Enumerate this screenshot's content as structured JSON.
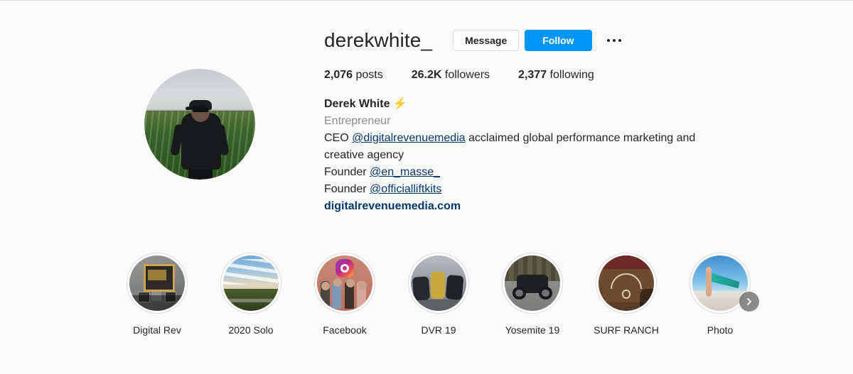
{
  "profile": {
    "username": "derekwhite_",
    "avatar_alt": "man-in-black-jacket-standing-in-green-crop-field",
    "actions": {
      "message_label": "Message",
      "follow_label": "Follow",
      "more_label": "More options"
    },
    "stats": [
      {
        "number": "2,076",
        "label": "posts"
      },
      {
        "number": "26.2K",
        "label": "followers"
      },
      {
        "number": "2,377",
        "label": "following"
      }
    ],
    "bio": {
      "full_name": "Derek White",
      "name_emoji": "⚡",
      "category": "Entrepreneur",
      "lines": [
        {
          "prefix": "CEO ",
          "mention": "@digitalrevenuemedia",
          "suffix": " acclaimed global performance marketing and creative agency"
        },
        {
          "prefix": "Founder ",
          "mention": "@en_masse_",
          "suffix": ""
        },
        {
          "prefix": "Founder ",
          "mention": "@officialliftkits",
          "suffix": ""
        }
      ],
      "website": "digitalrevenuemedia.com"
    }
  },
  "highlights": {
    "next_label": "Next",
    "items": [
      {
        "label": "Digital Rev",
        "art": "wall"
      },
      {
        "label": "2020 Solo",
        "art": "prairie"
      },
      {
        "label": "Facebook",
        "art": "instagram-backdrop"
      },
      {
        "label": "DVR 19",
        "art": "motorcycle-group"
      },
      {
        "label": "Yosemite 19",
        "art": "motorcycle-road"
      },
      {
        "label": "SURF RANCH",
        "art": "wooden-sign"
      },
      {
        "label": "Photo",
        "art": "teal-flag-beach"
      }
    ]
  },
  "colors": {
    "background": "#fafafa",
    "text": "#262626",
    "muted": "#8e8e8e",
    "accent_blue": "#0095f6",
    "link_navy": "#00376b",
    "border": "#dbdbdb"
  }
}
